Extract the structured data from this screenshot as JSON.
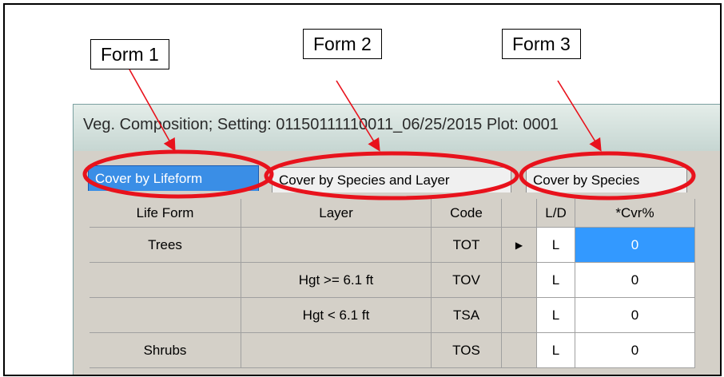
{
  "callouts": {
    "form1": "Form 1",
    "form2": "Form 2",
    "form3": "Form 3"
  },
  "window": {
    "title": "Veg. Composition; Setting: 01150111110011_06/25/2015 Plot: 0001"
  },
  "tabs": [
    {
      "label": "Cover by Lifeform",
      "active": true
    },
    {
      "label": "Cover by Species and Layer",
      "active": false
    },
    {
      "label": "Cover by Species",
      "active": false
    }
  ],
  "table": {
    "headers": [
      "Life Form",
      "Layer",
      "Code",
      "",
      "L/D",
      "*Cvr%"
    ],
    "rows": [
      {
        "life_form": "Trees",
        "layer": "",
        "code": "TOT",
        "indicator": "▶",
        "ld": "L",
        "cvr": "0"
      },
      {
        "life_form": "",
        "layer": "Hgt >= 6.1 ft",
        "code": "TOV",
        "indicator": "",
        "ld": "L",
        "cvr": "0"
      },
      {
        "life_form": "",
        "layer": "Hgt  < 6.1 ft",
        "code": "TSA",
        "indicator": "",
        "ld": "L",
        "cvr": "0"
      },
      {
        "life_form": "Shrubs",
        "layer": "",
        "code": "TOS",
        "indicator": "",
        "ld": "L",
        "cvr": "0"
      }
    ]
  },
  "colors": {
    "highlight": "#e8121c",
    "active_tab": "#3a8ee6",
    "selected_cell": "#3399ff"
  }
}
